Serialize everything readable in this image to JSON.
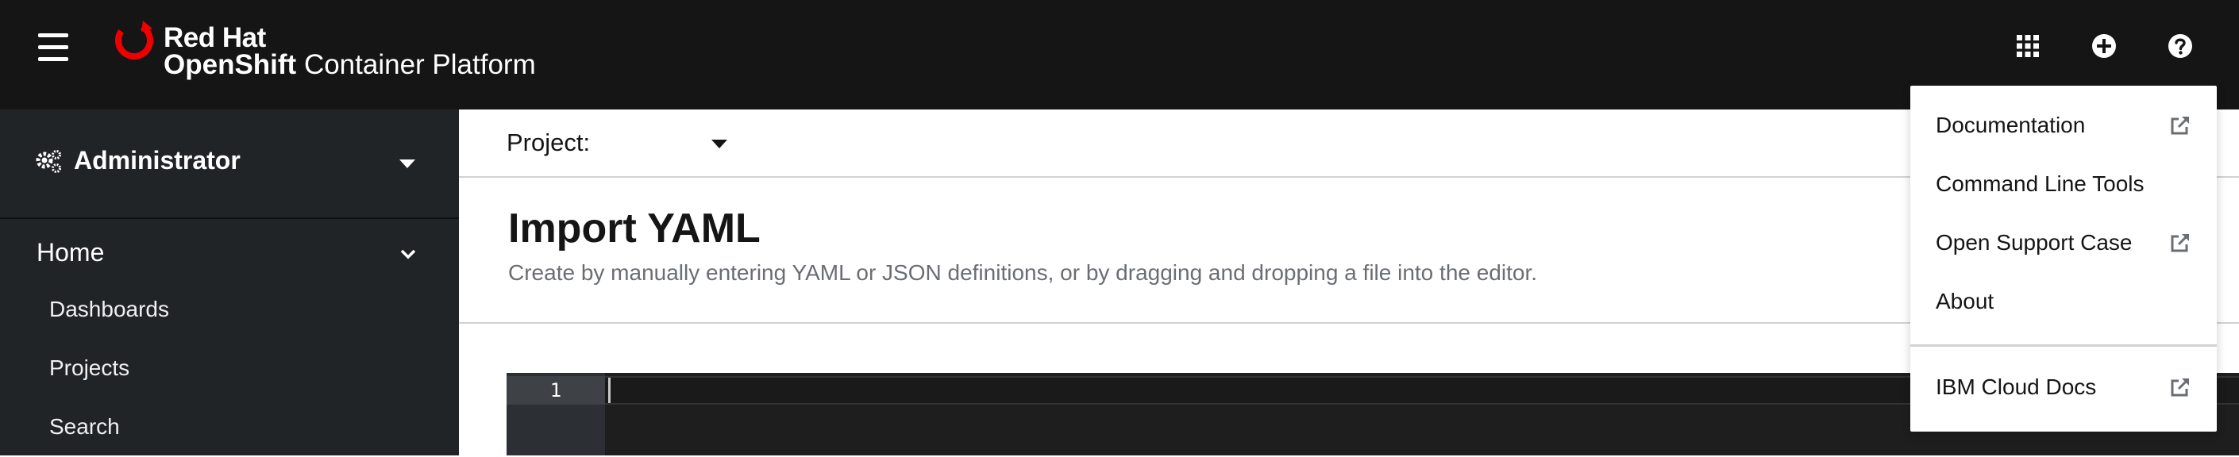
{
  "masthead": {
    "brand_top": "Red Hat",
    "brand_product_bold": "OpenShift",
    "brand_product_rest": " Container Platform",
    "icons": [
      "app-launcher-icon",
      "plus-circle-icon",
      "help-icon"
    ]
  },
  "sidebar": {
    "perspective": "Administrator",
    "section": {
      "label": "Home",
      "expanded": true
    },
    "items": [
      {
        "label": "Dashboards"
      },
      {
        "label": "Projects"
      },
      {
        "label": "Search"
      }
    ]
  },
  "project_bar": {
    "label": "Project:",
    "value": ""
  },
  "page": {
    "title": "Import YAML",
    "description": "Create by manually entering YAML or JSON definitions, or by dragging and dropping a file into the editor."
  },
  "editor": {
    "line_numbers": [
      "1"
    ]
  },
  "help_menu": {
    "items": [
      {
        "label": "Documentation",
        "external": true
      },
      {
        "label": "Command Line Tools",
        "external": false
      },
      {
        "label": "Open Support Case",
        "external": true
      },
      {
        "label": "About",
        "external": false
      }
    ],
    "secondary_items": [
      {
        "label": "IBM Cloud Docs",
        "external": true
      }
    ]
  },
  "colors": {
    "masthead_bg": "#151515",
    "sidebar_bg": "#212427",
    "brand_red": "#ee0000",
    "editor_bg": "#1e1e1e"
  }
}
